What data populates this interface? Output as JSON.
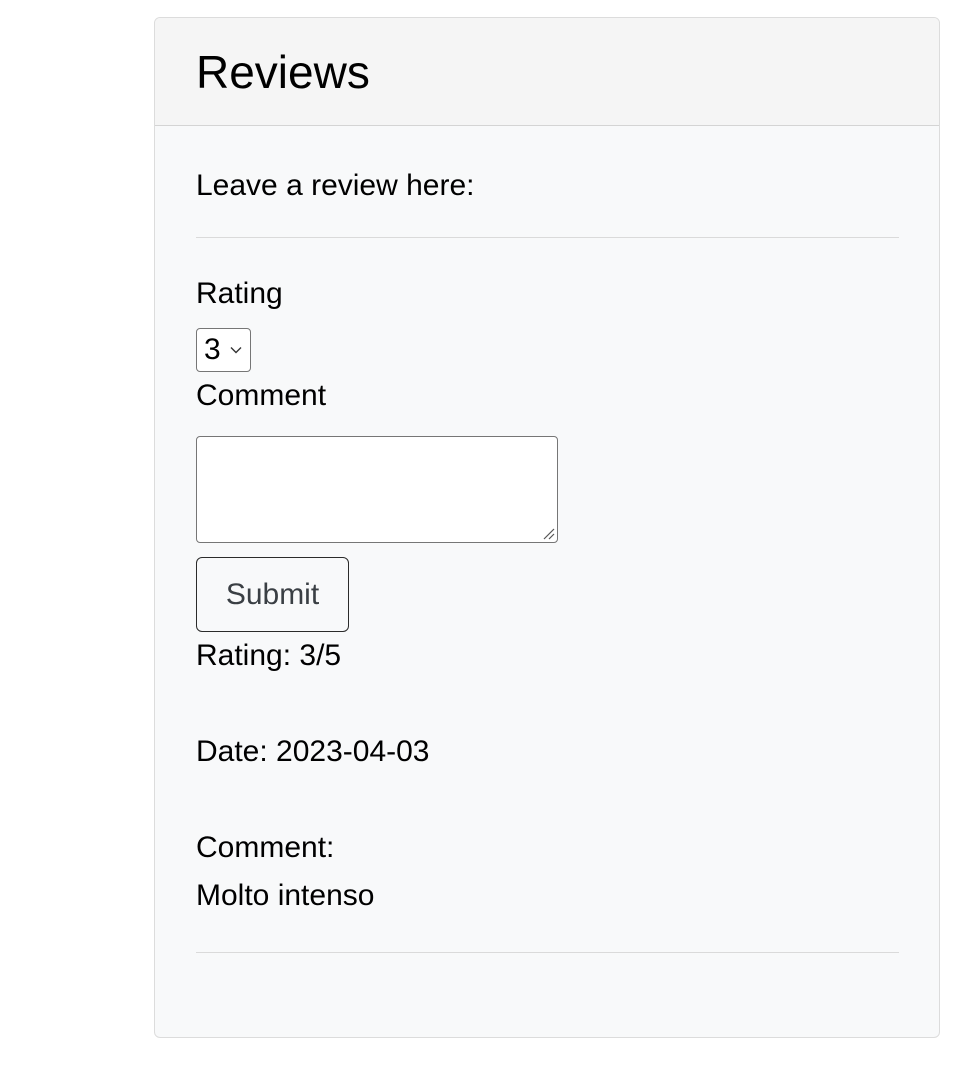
{
  "reviews": {
    "title": "Reviews",
    "intro": "Leave a review here:",
    "form": {
      "rating_label": "Rating",
      "rating_selected": "3",
      "comment_label": "Comment",
      "comment_value": "",
      "submit_label": "Submit"
    },
    "items": [
      {
        "rating_text": "Rating: 3/5",
        "date_text": "Date: 2023-04-03",
        "comment_label": "Comment:",
        "comment_text": "Molto intenso"
      }
    ]
  },
  "icons": {
    "select_arrow": "chevron-down-icon",
    "textarea_grip": "resize-grip-icon"
  }
}
